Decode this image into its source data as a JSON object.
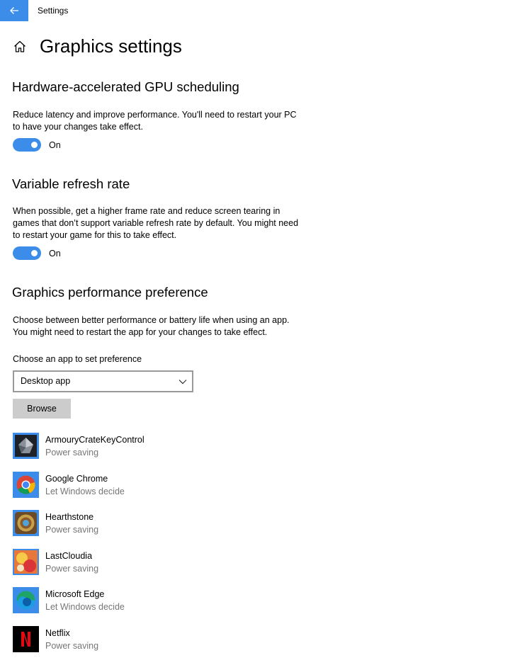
{
  "window": {
    "title": "Settings"
  },
  "page": {
    "title": "Graphics settings"
  },
  "gpu_scheduling": {
    "title": "Hardware-accelerated GPU scheduling",
    "description": "Reduce latency and improve performance. You'll need to restart your PC to have your changes take effect.",
    "toggle_state": "On"
  },
  "vrr": {
    "title": "Variable refresh rate",
    "description": "When possible, get a higher frame rate and reduce screen tearing in games that don’t support variable refresh rate by default. You might need to restart your game for this to take effect.",
    "toggle_state": "On"
  },
  "performance": {
    "title": "Graphics performance preference",
    "description": "Choose between better performance or battery life when using an app. You might need to restart the app for your changes to take effect.",
    "choose_label": "Choose an app to set preference",
    "dropdown_value": "Desktop app",
    "browse_label": "Browse"
  },
  "apps": [
    {
      "name": "ArmouryCrateKeyControl",
      "preference": "Power saving",
      "icon": "armoury-crate-icon"
    },
    {
      "name": "Google Chrome",
      "preference": "Let Windows decide",
      "icon": "chrome-icon"
    },
    {
      "name": "Hearthstone",
      "preference": "Power saving",
      "icon": "hearthstone-icon"
    },
    {
      "name": "LastCloudia",
      "preference": "Power saving",
      "icon": "lastcloudia-icon"
    },
    {
      "name": "Microsoft Edge",
      "preference": "Let Windows decide",
      "icon": "edge-icon"
    },
    {
      "name": "Netflix",
      "preference": "Power saving",
      "icon": "netflix-icon"
    }
  ],
  "colors": {
    "accent": "#3c8dea",
    "secondary_text": "#767676",
    "button_bg": "#cccccc"
  }
}
